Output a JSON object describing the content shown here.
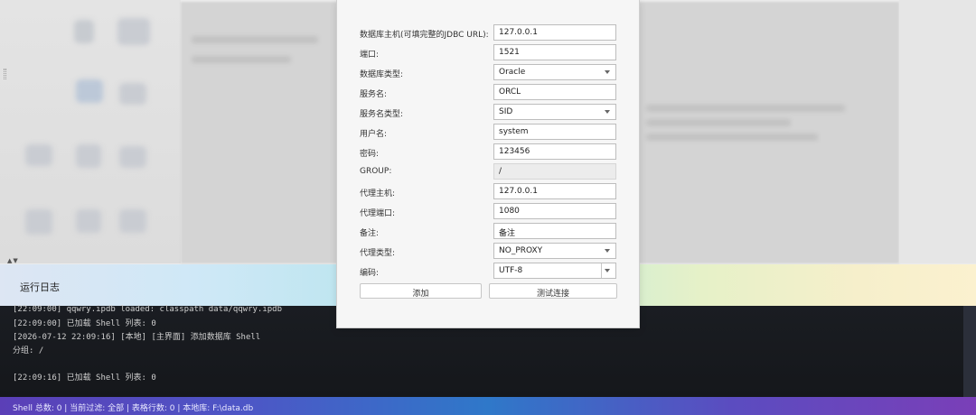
{
  "dialog": {
    "fields": [
      {
        "label": "数据库主机(可填完整的JDBC URL):",
        "value": "127.0.0.1",
        "kind": "input"
      },
      {
        "label": "端口:",
        "value": "1521",
        "kind": "input"
      },
      {
        "label": "数据库类型:",
        "value": "Oracle",
        "kind": "select"
      },
      {
        "label": "服务名:",
        "value": "ORCL",
        "kind": "input"
      },
      {
        "label": "服务名类型:",
        "value": "SID",
        "kind": "select"
      },
      {
        "label": "用户名:",
        "value": "system",
        "kind": "input"
      },
      {
        "label": "密码:",
        "value": "123456",
        "kind": "input"
      },
      {
        "label": "GROUP:",
        "value": "/",
        "kind": "readonly"
      },
      {
        "label": "代理主机:",
        "value": "127.0.0.1",
        "kind": "input"
      },
      {
        "label": "代理端口:",
        "value": "1080",
        "kind": "input"
      },
      {
        "label": "备注:",
        "value": "备注",
        "kind": "input"
      },
      {
        "label": "代理类型:",
        "value": "NO_PROXY",
        "kind": "select"
      },
      {
        "label": "编码:",
        "value": "UTF-8",
        "kind": "select-split"
      }
    ],
    "add_button": "添加",
    "test_button": "测试连接"
  },
  "log": {
    "title": "运行日志",
    "lines": [
      "[22:09:00] qqwry.ipdb loaded: classpath data/qqwry.ipdb",
      "[22:09:00] 已加载 Shell 列表: 0",
      "[2026-07-12 22:09:16] [本地] [主界面] 添加数据库 Shell",
      "分组: /",
      "",
      "[22:09:16] 已加载 Shell 列表: 0"
    ]
  },
  "status_bar": {
    "text": "Shell 总数: 0 | 当前过滤: 全部 | 表格行数: 0 | 本地库: F:\\data.db"
  }
}
